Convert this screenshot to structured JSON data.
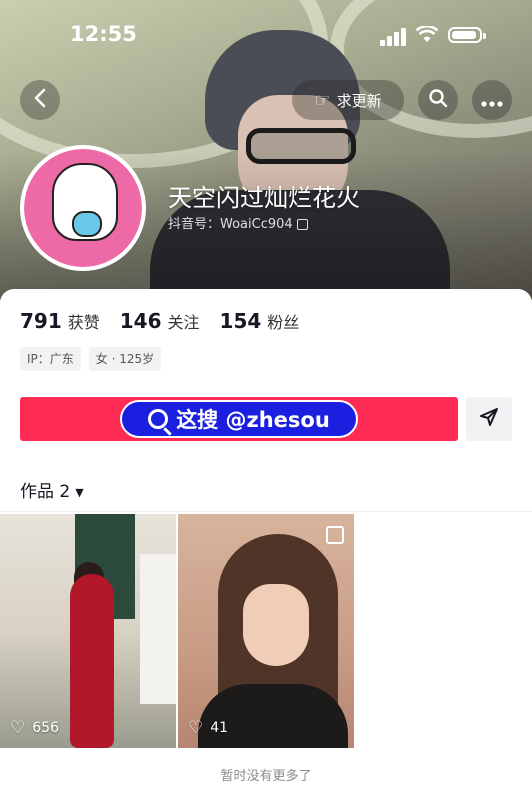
{
  "status_bar": {
    "time": "12:55"
  },
  "header": {
    "update_label": "求更新",
    "nickname": "天空闪过灿烂花火",
    "douyin_id": "抖音号：WoaiCc904"
  },
  "stats": [
    {
      "value": "791",
      "label": "获赞"
    },
    {
      "value": "146",
      "label": "关注"
    },
    {
      "value": "154",
      "label": "粉丝"
    }
  ],
  "tags": [
    "IP：广东",
    "女 · 125岁"
  ],
  "follow_banner": {
    "text": "这搜 @zhesou"
  },
  "works": {
    "tab_label": "作品 2",
    "items": [
      {
        "likes": "656"
      },
      {
        "likes": "41"
      }
    ],
    "end_text": "暂时没有更多了"
  },
  "colors": {
    "accent": "#fe2c55",
    "banner_pill": "#1a1fe0",
    "avatar_bg": "#ee6aa7"
  }
}
